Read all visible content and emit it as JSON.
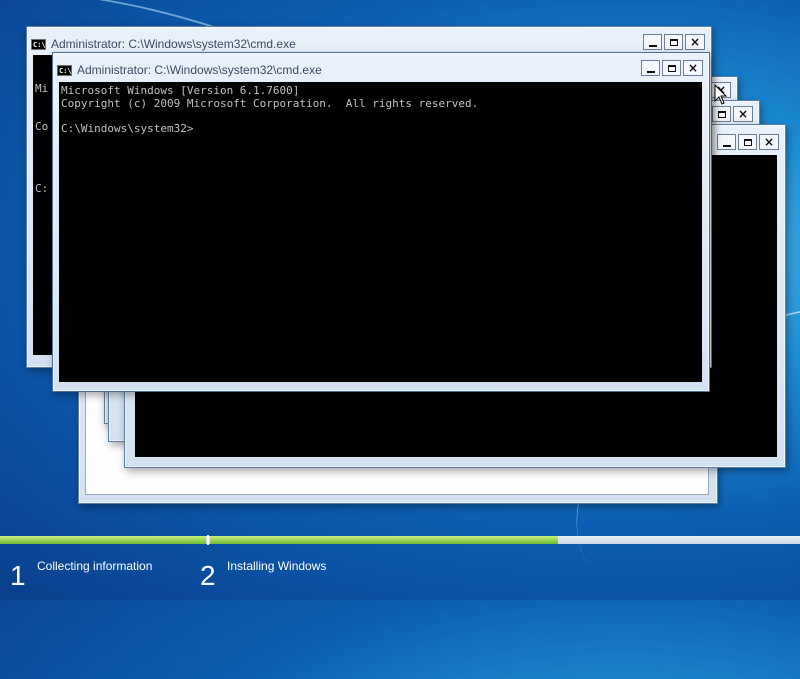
{
  "background": {
    "accent": "#1d8fd6"
  },
  "windows": {
    "back_window": {
      "title": "Administrator: C:\\Windows\\system32\\cmd.exe",
      "partial_lines": [
        "Mi",
        "Co",
        "",
        "C:"
      ]
    },
    "front_window": {
      "title": "Administrator: C:\\Windows\\system32\\cmd.exe",
      "console_text": "Microsoft Windows [Version 6.1.7600]\nCopyright (c) 2009 Microsoft Corporation.  All rights reserved.\n\nC:\\Windows\\system32>"
    },
    "controls": {
      "minimize": "minimize",
      "maximize": "maximize",
      "close": "×"
    }
  },
  "setup_progress": {
    "steps": [
      {
        "number": "1",
        "label": "Collecting information"
      },
      {
        "number": "2",
        "label": "Installing Windows"
      }
    ],
    "progress_fraction": 0.7
  }
}
